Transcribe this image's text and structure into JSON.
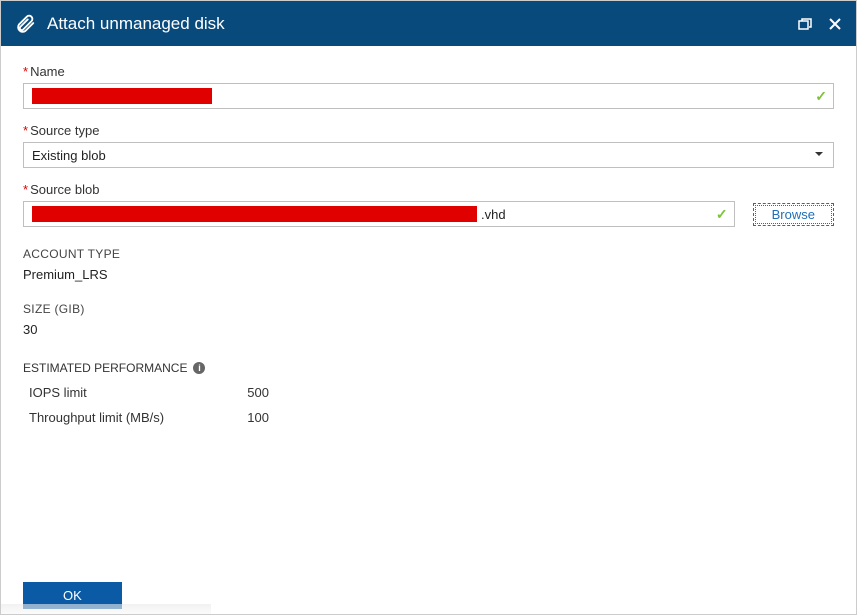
{
  "titlebar": {
    "title": "Attach unmanaged disk"
  },
  "fields": {
    "name": {
      "label": "Name"
    },
    "sourceType": {
      "label": "Source type",
      "value": "Existing blob"
    },
    "sourceBlob": {
      "label": "Source blob",
      "suffix": ".vhd",
      "browse": "Browse"
    }
  },
  "account": {
    "label": "ACCOUNT TYPE",
    "value": "Premium_LRS"
  },
  "size": {
    "label": "SIZE (GIB)",
    "value": "30"
  },
  "performance": {
    "header": "ESTIMATED PERFORMANCE",
    "rows": [
      {
        "k": "IOPS limit",
        "v": "500"
      },
      {
        "k": "Throughput limit (MB/s)",
        "v": "100"
      }
    ]
  },
  "footer": {
    "ok": "OK"
  }
}
